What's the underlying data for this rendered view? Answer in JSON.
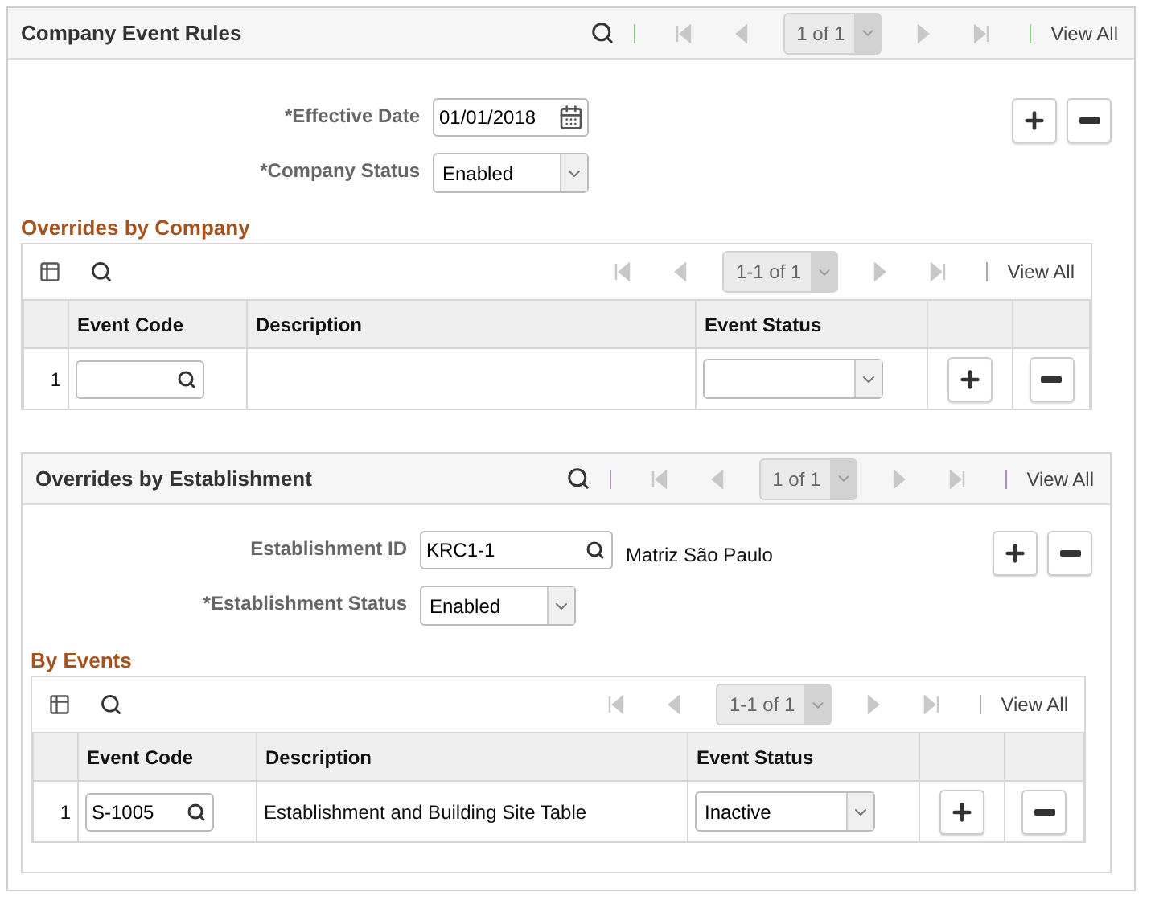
{
  "header": {
    "title": "Company Event Rules",
    "page": "1 of 1",
    "view_all": "View All"
  },
  "effective_date": {
    "label": "*Effective Date",
    "value": "01/01/2018"
  },
  "company_status": {
    "label": "*Company Status",
    "value": "Enabled"
  },
  "overrides_by_company": {
    "title": "Overrides by Company",
    "grid": {
      "page": "1-1 of 1",
      "view_all": "View All",
      "columns": [
        "Event Code",
        "Description",
        "Event Status"
      ],
      "rows": [
        {
          "number": "1"
        }
      ]
    }
  },
  "overrides_by_establishment": {
    "title": "Overrides by Establishment",
    "page": "1 of 1",
    "view_all": "View All",
    "establishment_id": {
      "label": "Establishment ID",
      "value": "KRC1-1",
      "description": "Matriz São Paulo"
    },
    "establishment_status": {
      "label": "*Establishment Status",
      "value": "Enabled"
    },
    "by_events": {
      "title": "By Events",
      "grid": {
        "page": "1-1 of 1",
        "view_all": "View All",
        "columns": [
          "Event Code",
          "Description",
          "Event Status"
        ],
        "rows": [
          {
            "number": "1",
            "event_code": "S-1005",
            "description": "Establishment and Building Site Table",
            "event_status": "Inactive"
          }
        ]
      }
    }
  }
}
